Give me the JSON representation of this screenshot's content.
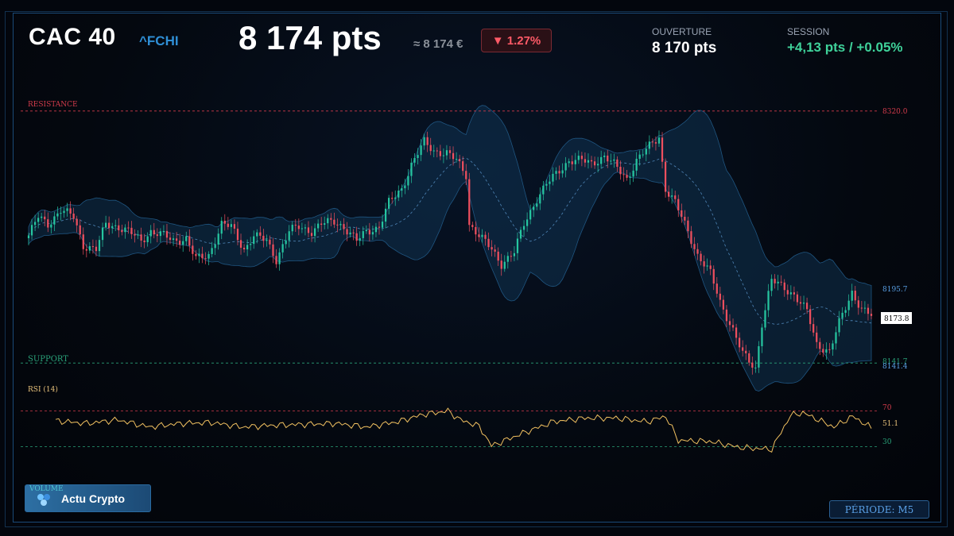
{
  "header": {
    "title": "CAC 40",
    "ticker": "^FCHI",
    "price": "8 174 pts",
    "approx": "≈ 8 174 €",
    "change": "▼ 1.27%",
    "open_label": "OUVERTURE",
    "open_value": "8 170 pts",
    "session_label": "SESSION",
    "session_value": "+4,13 pts / +0.05%"
  },
  "footer": {
    "volume_label": "VOLUME",
    "logo_text": "Actu Crypto",
    "period": "PÉRIODE: M5"
  },
  "colors": {
    "up": "#26c6a0",
    "down": "#ef4f5e",
    "resistance": "#d23b4b",
    "support": "#2aa37a",
    "rsi_line": "#f0c060",
    "accent": "#2f8fd6",
    "session_positive": "#3fd29a"
  },
  "chart_data": [
    {
      "type": "candlestick",
      "series": [
        {
          "name": "",
          "values": []
        }
      ],
      "levels": {
        "resistance": {
          "label": "RESISTANCE",
          "value": 8320.0,
          "value_label": "8320.0"
        },
        "support": {
          "label": "SUPPORT",
          "value": 8141.7,
          "value_label": "8141.7"
        },
        "upper_band_label": "8195.7",
        "lower_band_label": "8141.4",
        "last_price_label": "8173.8"
      },
      "close_points": [
        [
          0,
          8232
        ],
        [
          3,
          8245
        ],
        [
          6,
          8240
        ],
        [
          10,
          8250
        ],
        [
          14,
          8245
        ],
        [
          17,
          8225
        ],
        [
          21,
          8222
        ],
        [
          24,
          8240
        ],
        [
          28,
          8238
        ],
        [
          31,
          8235
        ],
        [
          35,
          8228
        ],
        [
          38,
          8235
        ],
        [
          42,
          8232
        ],
        [
          45,
          8228
        ],
        [
          49,
          8230
        ],
        [
          52,
          8215
        ],
        [
          56,
          8218
        ],
        [
          60,
          8240
        ],
        [
          63,
          8238
        ],
        [
          67,
          8222
        ],
        [
          70,
          8232
        ],
        [
          74,
          8228
        ],
        [
          77,
          8215
        ],
        [
          81,
          8235
        ],
        [
          84,
          8238
        ],
        [
          88,
          8235
        ],
        [
          91,
          8240
        ],
        [
          95,
          8242
        ],
        [
          98,
          8238
        ],
        [
          102,
          8228
        ],
        [
          105,
          8235
        ],
        [
          109,
          8238
        ],
        [
          112,
          8255
        ],
        [
          116,
          8265
        ],
        [
          119,
          8282
        ],
        [
          123,
          8298
        ],
        [
          126,
          8292
        ],
        [
          130,
          8290
        ],
        [
          133,
          8285
        ],
        [
          136,
          8275
        ],
        [
          137,
          8240
        ],
        [
          140,
          8232
        ],
        [
          144,
          8222
        ],
        [
          147,
          8212
        ],
        [
          151,
          8220
        ],
        [
          154,
          8240
        ],
        [
          158,
          8258
        ],
        [
          161,
          8268
        ],
        [
          165,
          8278
        ],
        [
          168,
          8285
        ],
        [
          172,
          8285
        ],
        [
          175,
          8283
        ],
        [
          179,
          8288
        ],
        [
          182,
          8282
        ],
        [
          186,
          8272
        ],
        [
          189,
          8285
        ],
        [
          193,
          8295
        ],
        [
          196,
          8302
        ],
        [
          198,
          8265
        ],
        [
          201,
          8255
        ],
        [
          205,
          8235
        ],
        [
          208,
          8218
        ],
        [
          212,
          8205
        ],
        [
          215,
          8185
        ],
        [
          219,
          8165
        ],
        [
          222,
          8148
        ],
        [
          226,
          8138
        ],
        [
          228,
          8170
        ],
        [
          231,
          8200
        ],
        [
          235,
          8195
        ],
        [
          238,
          8190
        ],
        [
          242,
          8178
        ],
        [
          245,
          8155
        ],
        [
          249,
          8150
        ],
        [
          252,
          8170
        ],
        [
          256,
          8192
        ],
        [
          259,
          8180
        ],
        [
          262,
          8175
        ]
      ],
      "ylim": [
        8130,
        8330
      ]
    },
    {
      "type": "line",
      "title": "RSI (14)",
      "levels": [
        70,
        30
      ],
      "level_labels": [
        "70",
        "30"
      ],
      "last_label": "51.1",
      "x": [
        0,
        10,
        20,
        30,
        40,
        50,
        60,
        70,
        80,
        90,
        100,
        110,
        118,
        126,
        130,
        136,
        140,
        150,
        160,
        170,
        180,
        190,
        196,
        200,
        210,
        220,
        230,
        236,
        240,
        250,
        256,
        262
      ],
      "values": [
        59,
        56,
        60,
        52,
        56,
        57,
        52,
        54,
        55,
        56,
        52,
        58,
        66,
        70,
        60,
        53,
        31,
        45,
        58,
        62,
        62,
        58,
        64,
        37,
        36,
        29,
        27,
        65,
        68,
        52,
        64,
        51
      ],
      "ylim": [
        10,
        90
      ]
    }
  ]
}
